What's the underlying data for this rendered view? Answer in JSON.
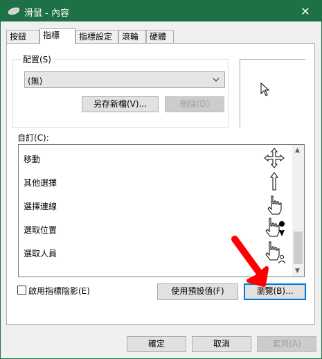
{
  "window": {
    "title": "滑鼠 - 內容",
    "close_glyph": "✕"
  },
  "tabs": [
    "按鈕",
    "指標",
    "指標設定",
    "滾輪",
    "硬體"
  ],
  "scheme": {
    "label": "配置(S)",
    "selected": "(無)",
    "save_as_button": "另存新檔(V)...",
    "delete_button": "刪除(D)"
  },
  "customize": {
    "label": "自訂(C):",
    "items": [
      {
        "label": "移動",
        "icon": "move-cursor-icon"
      },
      {
        "label": "其他選擇",
        "icon": "up-arrow-cursor-icon"
      },
      {
        "label": "選擇連線",
        "icon": "hand-cursor-icon"
      },
      {
        "label": "選取位置",
        "icon": "hand-pin-cursor-icon"
      },
      {
        "label": "選取人員",
        "icon": "hand-person-cursor-icon"
      }
    ]
  },
  "shadow_checkbox": {
    "label": "啟用指標陰影(E)",
    "checked": false
  },
  "use_default_button": "使用預設值(F)",
  "browse_button": "瀏覽(B)...",
  "footer": {
    "ok": "確定",
    "cancel": "取消",
    "apply": "套用(A)"
  },
  "colors": {
    "titlebar": "#1e7145",
    "annotation_arrow": "#ff0000"
  }
}
